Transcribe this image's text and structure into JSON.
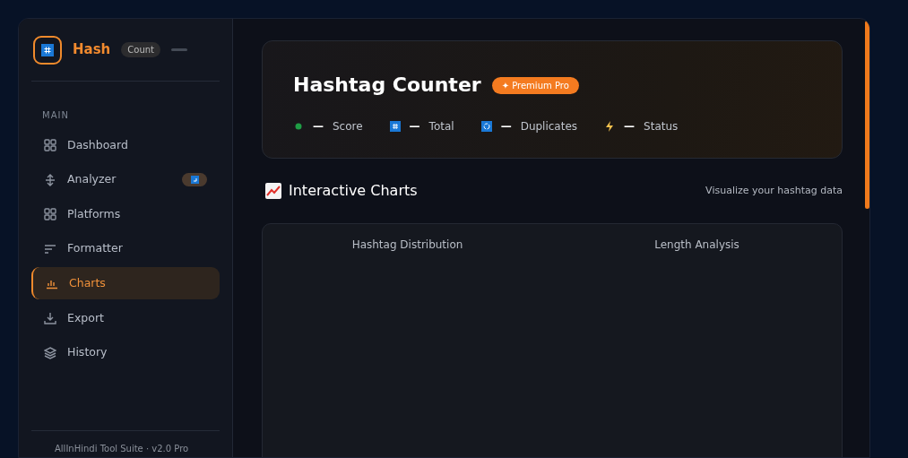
{
  "brand": {
    "name": "Hash",
    "tag": "Count"
  },
  "sidebar": {
    "section": "MAIN",
    "items": [
      {
        "label": "Dashboard",
        "selected": false,
        "badge": false
      },
      {
        "label": "Analyzer",
        "selected": false,
        "badge": true
      },
      {
        "label": "Platforms",
        "selected": false,
        "badge": false
      },
      {
        "label": "Formatter",
        "selected": false,
        "badge": false
      },
      {
        "label": "Charts",
        "selected": true,
        "badge": false
      },
      {
        "label": "Export",
        "selected": false,
        "badge": false
      },
      {
        "label": "History",
        "selected": false,
        "badge": false
      }
    ],
    "footer": "AllInHindi Tool Suite · v2.0 Pro"
  },
  "hero": {
    "title": "Hashtag Counter",
    "badge": "✦ Premium Pro",
    "stats": [
      {
        "kind": "dot",
        "value": "—",
        "label": "Score"
      },
      {
        "kind": "hash",
        "value": "—",
        "label": "Total"
      },
      {
        "kind": "cycle",
        "value": "—",
        "label": "Duplicates"
      },
      {
        "kind": "bolt",
        "value": "—",
        "label": "Status"
      }
    ]
  },
  "section": {
    "title": "Interactive Charts",
    "subtitle": "Visualize your hashtag data"
  },
  "charts": [
    {
      "title": "Hashtag Distribution"
    },
    {
      "title": "Length Analysis"
    }
  ]
}
